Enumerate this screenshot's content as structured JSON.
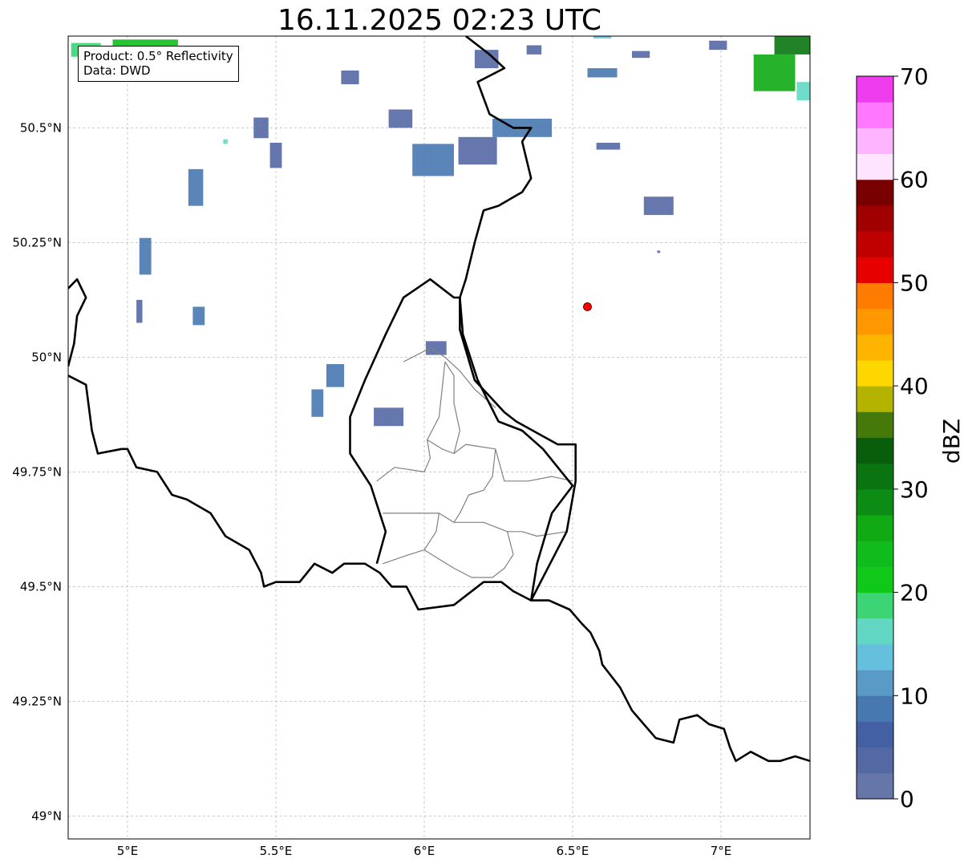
{
  "title": "16.11.2025 02:23 UTC",
  "info": {
    "product": "Product: 0.5° Reflectivity",
    "source": "Data: DWD"
  },
  "axes": {
    "lon_range": [
      4.8,
      7.3
    ],
    "lat_range": [
      48.95,
      50.7
    ],
    "x_ticks": [
      {
        "value": 5.0,
        "label": "5°E"
      },
      {
        "value": 5.5,
        "label": "5.5°E"
      },
      {
        "value": 6.0,
        "label": "6°E"
      },
      {
        "value": 6.5,
        "label": "6.5°E"
      },
      {
        "value": 7.0,
        "label": "7°E"
      }
    ],
    "y_ticks": [
      {
        "value": 49.0,
        "label": "49°N"
      },
      {
        "value": 49.25,
        "label": "49.25°N"
      },
      {
        "value": 49.5,
        "label": "49.5°N"
      },
      {
        "value": 49.75,
        "label": "49.75°N"
      },
      {
        "value": 50.0,
        "label": "50°N"
      },
      {
        "value": 50.25,
        "label": "50.25°N"
      },
      {
        "value": 50.5,
        "label": "50.5°N"
      }
    ],
    "grid": true
  },
  "colorbar": {
    "label": "dBZ",
    "range": [
      0,
      70
    ],
    "step": 2.5,
    "ticks": [
      {
        "value": 0,
        "label": "0"
      },
      {
        "value": 10,
        "label": "10"
      },
      {
        "value": 20,
        "label": "20"
      },
      {
        "value": 30,
        "label": "30"
      },
      {
        "value": 40,
        "label": "40"
      },
      {
        "value": 50,
        "label": "50"
      },
      {
        "value": 60,
        "label": "60"
      },
      {
        "value": 70,
        "label": "70"
      }
    ],
    "colors": [
      "#6676a8",
      "#5468a4",
      "#4460a4",
      "#4878b0",
      "#5a9ac6",
      "#64c0dc",
      "#62d8c4",
      "#3cd474",
      "#10c818",
      "#10bc1c",
      "#10aa14",
      "#0c8c14",
      "#0a7410",
      "#085e0a",
      "#457a0a",
      "#b4b400",
      "#ffd700",
      "#ffb400",
      "#ff9800",
      "#ff7c00",
      "#e60000",
      "#c00000",
      "#a00000",
      "#780000",
      "#ffe4ff",
      "#ffb4ff",
      "#ff78ff",
      "#ee3cee"
    ]
  },
  "marker": {
    "lon": 6.55,
    "lat": 50.11,
    "color": "#ff0000"
  },
  "colors": {
    "background": "#ffffff",
    "national_border": "#000000",
    "district_border": "#808080",
    "grid": "#bbbbbb"
  },
  "map_features": {
    "national_borders": [
      [
        [
          4.8,
          50.15
        ],
        [
          4.83,
          50.17
        ],
        [
          4.86,
          50.13
        ],
        [
          4.83,
          50.09
        ],
        [
          4.82,
          50.03
        ],
        [
          4.8,
          49.98
        ]
      ],
      [
        [
          4.8,
          49.96
        ],
        [
          4.86,
          49.94
        ],
        [
          4.88,
          49.84
        ],
        [
          4.9,
          49.79
        ],
        [
          4.98,
          49.8
        ],
        [
          5.0,
          49.8
        ],
        [
          5.03,
          49.76
        ],
        [
          5.1,
          49.75
        ],
        [
          5.15,
          49.7
        ],
        [
          5.2,
          49.69
        ],
        [
          5.28,
          49.66
        ],
        [
          5.33,
          49.61
        ],
        [
          5.41,
          49.58
        ],
        [
          5.45,
          49.53
        ],
        [
          5.46,
          49.5
        ],
        [
          5.5,
          49.51
        ],
        [
          5.58,
          49.51
        ],
        [
          5.63,
          49.55
        ],
        [
          5.69,
          49.53
        ],
        [
          5.73,
          49.55
        ],
        [
          5.8,
          49.55
        ],
        [
          5.85,
          49.53
        ],
        [
          5.89,
          49.5
        ],
        [
          5.94,
          49.5
        ],
        [
          5.98,
          49.45
        ],
        [
          6.1,
          49.46
        ],
        [
          6.14,
          49.48
        ],
        [
          6.2,
          49.51
        ],
        [
          6.26,
          49.51
        ],
        [
          6.3,
          49.49
        ],
        [
          6.36,
          49.47
        ],
        [
          6.42,
          49.47
        ],
        [
          6.49,
          49.45
        ],
        [
          6.53,
          49.42
        ],
        [
          6.56,
          49.4
        ],
        [
          6.59,
          49.36
        ],
        [
          6.6,
          49.33
        ],
        [
          6.66,
          49.28
        ],
        [
          6.7,
          49.23
        ],
        [
          6.74,
          49.2
        ],
        [
          6.78,
          49.17
        ],
        [
          6.84,
          49.16
        ],
        [
          6.86,
          49.21
        ],
        [
          6.92,
          49.22
        ],
        [
          6.96,
          49.2
        ],
        [
          7.01,
          49.19
        ],
        [
          7.03,
          49.15
        ],
        [
          7.05,
          49.12
        ],
        [
          7.1,
          49.14
        ],
        [
          7.16,
          49.12
        ],
        [
          7.2,
          49.12
        ],
        [
          7.25,
          49.13
        ],
        [
          7.3,
          49.12
        ]
      ],
      [
        [
          5.84,
          49.55
        ],
        [
          5.87,
          49.62
        ],
        [
          5.82,
          49.72
        ],
        [
          5.75,
          49.79
        ],
        [
          5.75,
          49.83
        ],
        [
          5.75,
          49.87
        ],
        [
          5.8,
          49.95
        ],
        [
          5.87,
          50.05
        ],
        [
          5.93,
          50.13
        ],
        [
          6.02,
          50.17
        ],
        [
          6.1,
          50.13
        ],
        [
          6.12,
          50.13
        ],
        [
          6.13,
          50.05
        ],
        [
          6.18,
          49.95
        ],
        [
          6.25,
          49.86
        ],
        [
          6.33,
          49.84
        ],
        [
          6.4,
          49.8
        ],
        [
          6.5,
          49.72
        ],
        [
          6.43,
          49.66
        ],
        [
          6.38,
          49.55
        ],
        [
          6.36,
          49.47
        ]
      ],
      [
        [
          6.36,
          49.47
        ],
        [
          6.48,
          49.62
        ],
        [
          6.51,
          49.73
        ],
        [
          6.51,
          49.81
        ],
        [
          6.45,
          49.81
        ],
        [
          6.31,
          49.86
        ],
        [
          6.27,
          49.88
        ],
        [
          6.17,
          49.95
        ],
        [
          6.12,
          50.06
        ],
        [
          6.12,
          50.13
        ],
        [
          6.14,
          50.17
        ],
        [
          6.17,
          50.25
        ],
        [
          6.2,
          50.32
        ],
        [
          6.25,
          50.33
        ],
        [
          6.33,
          50.36
        ],
        [
          6.36,
          50.39
        ],
        [
          6.33,
          50.47
        ],
        [
          6.36,
          50.5
        ],
        [
          6.3,
          50.5
        ],
        [
          6.22,
          50.53
        ],
        [
          6.18,
          50.6
        ],
        [
          6.27,
          50.63
        ],
        [
          6.22,
          50.66
        ],
        [
          6.14,
          50.7
        ]
      ]
    ],
    "district_borders": [
      [
        [
          5.93,
          49.99
        ],
        [
          6.02,
          50.02
        ],
        [
          6.07,
          50.0
        ],
        [
          6.12,
          49.97
        ],
        [
          6.17,
          49.93
        ],
        [
          6.24,
          49.89
        ]
      ],
      [
        [
          6.07,
          49.99
        ],
        [
          6.05,
          49.87
        ],
        [
          6.01,
          49.82
        ],
        [
          6.06,
          49.8
        ],
        [
          6.1,
          49.79
        ],
        [
          6.14,
          49.81
        ],
        [
          6.24,
          49.8
        ],
        [
          6.27,
          49.73
        ],
        [
          6.35,
          49.73
        ],
        [
          6.43,
          49.74
        ],
        [
          6.5,
          49.73
        ]
      ],
      [
        [
          5.84,
          49.73
        ],
        [
          5.9,
          49.76
        ],
        [
          6.0,
          49.75
        ],
        [
          6.02,
          49.78
        ],
        [
          6.01,
          49.82
        ]
      ],
      [
        [
          5.86,
          49.66
        ],
        [
          6.05,
          49.66
        ],
        [
          6.1,
          49.64
        ],
        [
          6.2,
          49.64
        ],
        [
          6.28,
          49.62
        ],
        [
          6.33,
          49.62
        ],
        [
          6.38,
          49.61
        ],
        [
          6.48,
          49.62
        ]
      ],
      [
        [
          5.86,
          49.55
        ],
        [
          5.95,
          49.57
        ],
        [
          6.0,
          49.58
        ],
        [
          6.05,
          49.56
        ],
        [
          6.1,
          49.54
        ],
        [
          6.16,
          49.52
        ],
        [
          6.23,
          49.52
        ],
        [
          6.27,
          49.54
        ],
        [
          6.3,
          49.57
        ],
        [
          6.28,
          49.62
        ]
      ],
      [
        [
          6.0,
          49.58
        ],
        [
          6.04,
          49.62
        ],
        [
          6.05,
          49.66
        ]
      ],
      [
        [
          6.1,
          49.79
        ],
        [
          6.12,
          49.84
        ],
        [
          6.1,
          49.9
        ],
        [
          6.1,
          49.96
        ],
        [
          6.07,
          49.99
        ]
      ],
      [
        [
          6.24,
          49.8
        ],
        [
          6.23,
          49.74
        ],
        [
          6.2,
          49.71
        ],
        [
          6.15,
          49.7
        ],
        [
          6.12,
          49.66
        ],
        [
          6.1,
          49.64
        ]
      ]
    ],
    "radar_echoes": [
      {
        "lon": 4.86,
        "lat": 50.67,
        "w": 0.1,
        "h": 0.03,
        "color": "#3cd474"
      },
      {
        "lon": 5.06,
        "lat": 50.68,
        "w": 0.22,
        "h": 0.025,
        "color": "#10bc1c"
      },
      {
        "lon": 5.05,
        "lat": 50.66,
        "w": 0.08,
        "h": 0.02,
        "color": "#4878b0"
      },
      {
        "lon": 7.18,
        "lat": 50.62,
        "w": 0.14,
        "h": 0.08,
        "color": "#10aa14"
      },
      {
        "lon": 7.24,
        "lat": 50.68,
        "w": 0.12,
        "h": 0.04,
        "color": "#0a7410"
      },
      {
        "lon": 7.28,
        "lat": 50.58,
        "w": 0.05,
        "h": 0.04,
        "color": "#62d8c4"
      },
      {
        "lon": 6.99,
        "lat": 50.68,
        "w": 0.06,
        "h": 0.02,
        "color": "#5468a4"
      },
      {
        "lon": 5.45,
        "lat": 50.5,
        "w": 0.05,
        "h": 0.045,
        "color": "#5468a4"
      },
      {
        "lon": 5.5,
        "lat": 50.44,
        "w": 0.04,
        "h": 0.055,
        "color": "#5468a4"
      },
      {
        "lon": 5.23,
        "lat": 50.37,
        "w": 0.05,
        "h": 0.08,
        "color": "#4878b0"
      },
      {
        "lon": 5.33,
        "lat": 50.47,
        "w": 0.015,
        "h": 0.01,
        "color": "#62d8c4"
      },
      {
        "lon": 5.75,
        "lat": 50.61,
        "w": 0.06,
        "h": 0.03,
        "color": "#5468a4"
      },
      {
        "lon": 5.92,
        "lat": 50.52,
        "w": 0.08,
        "h": 0.04,
        "color": "#5468a4"
      },
      {
        "lon": 6.03,
        "lat": 50.43,
        "w": 0.14,
        "h": 0.07,
        "color": "#4878b0"
      },
      {
        "lon": 6.18,
        "lat": 50.45,
        "w": 0.13,
        "h": 0.06,
        "color": "#5468a4"
      },
      {
        "lon": 6.33,
        "lat": 50.5,
        "w": 0.2,
        "h": 0.04,
        "color": "#4878b0"
      },
      {
        "lon": 6.21,
        "lat": 50.65,
        "w": 0.08,
        "h": 0.04,
        "color": "#5468a4"
      },
      {
        "lon": 6.37,
        "lat": 50.67,
        "w": 0.05,
        "h": 0.02,
        "color": "#5468a4"
      },
      {
        "lon": 6.6,
        "lat": 50.62,
        "w": 0.1,
        "h": 0.02,
        "color": "#4878b0"
      },
      {
        "lon": 6.6,
        "lat": 50.7,
        "w": 0.06,
        "h": 0.01,
        "color": "#64c0dc"
      },
      {
        "lon": 6.73,
        "lat": 50.66,
        "w": 0.06,
        "h": 0.015,
        "color": "#5468a4"
      },
      {
        "lon": 6.79,
        "lat": 50.33,
        "w": 0.1,
        "h": 0.04,
        "color": "#5468a4"
      },
      {
        "lon": 6.62,
        "lat": 50.46,
        "w": 0.08,
        "h": 0.015,
        "color": "#5468a4"
      },
      {
        "lon": 5.06,
        "lat": 50.22,
        "w": 0.04,
        "h": 0.08,
        "color": "#4878b0"
      },
      {
        "lon": 5.04,
        "lat": 50.1,
        "w": 0.02,
        "h": 0.05,
        "color": "#5468a4"
      },
      {
        "lon": 5.24,
        "lat": 50.09,
        "w": 0.04,
        "h": 0.04,
        "color": "#4878b0"
      },
      {
        "lon": 5.7,
        "lat": 49.96,
        "w": 0.06,
        "h": 0.05,
        "color": "#4878b0"
      },
      {
        "lon": 5.64,
        "lat": 49.9,
        "w": 0.04,
        "h": 0.06,
        "color": "#4878b0"
      },
      {
        "lon": 5.88,
        "lat": 49.87,
        "w": 0.1,
        "h": 0.04,
        "color": "#5468a4"
      },
      {
        "lon": 6.04,
        "lat": 50.02,
        "w": 0.07,
        "h": 0.03,
        "color": "#5468a4"
      },
      {
        "lon": 6.79,
        "lat": 50.23,
        "w": 0.01,
        "h": 0.005,
        "color": "#5468a4"
      }
    ]
  }
}
